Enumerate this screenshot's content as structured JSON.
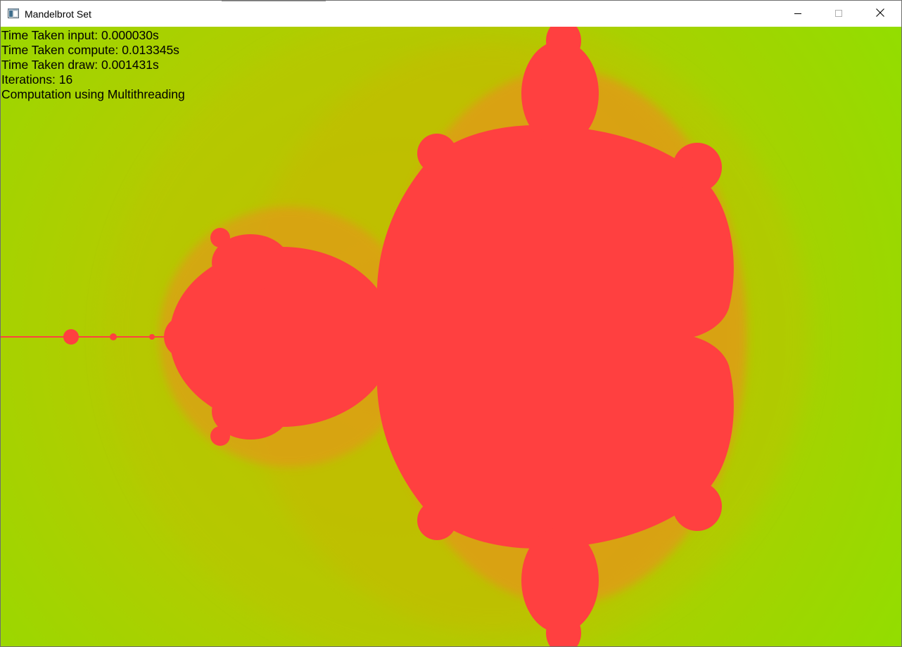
{
  "window": {
    "title": "Mandelbrot Set",
    "icon": "app-window-icon",
    "controls": {
      "minimize_icon": "minimize-icon",
      "maximize_icon": "maximize-icon",
      "close_icon": "close-icon"
    }
  },
  "stats": {
    "input_time": "Time Taken input: 0.000030s",
    "compute_time": "Time Taken compute: 0.013345s",
    "draw_time": "Time Taken draw: 0.001431s",
    "iterations": "Iterations: 16",
    "mode": "Computation using Multithreading"
  },
  "fractal": {
    "max_iterations": 16,
    "colors": {
      "set": "#ff4040",
      "outer": "#90e000",
      "band_near": "#f08a20",
      "band_mid": "#d2b400",
      "band_far": "#aad400"
    }
  }
}
